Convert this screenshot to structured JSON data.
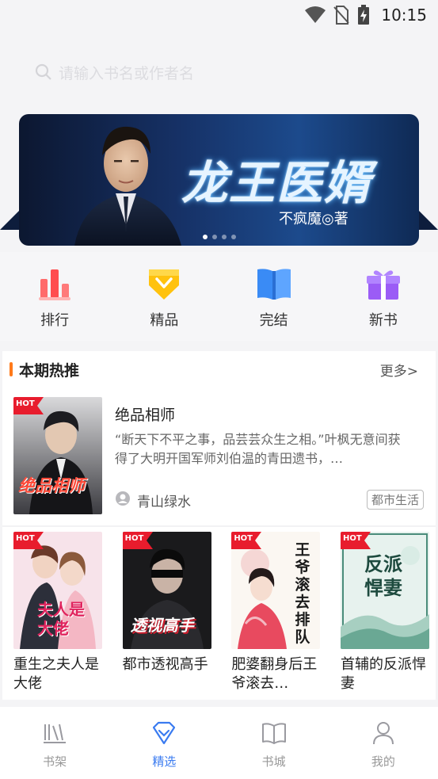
{
  "status_bar": {
    "time": "10:15",
    "icons": [
      "wifi-icon",
      "no-sim-icon",
      "battery-charging-icon"
    ]
  },
  "search": {
    "placeholder": "请输入书名或作者名",
    "icon": "search-icon"
  },
  "banner": {
    "title": "龙王医婿",
    "subtitle": "不疯魔◎著",
    "dots": 4,
    "active_dot": 0
  },
  "categories": [
    {
      "label": "排行",
      "icon": "ranking-bars-icon",
      "color": "#ff4d4f"
    },
    {
      "label": "精品",
      "icon": "diamond-badge-icon",
      "color": "#ffc20e"
    },
    {
      "label": "完结",
      "icon": "open-book-icon",
      "color": "#3a8bf5"
    },
    {
      "label": "新书",
      "icon": "gift-icon",
      "color": "#9b5cf6"
    }
  ],
  "section": {
    "title": "本期热推",
    "more": "更多>",
    "accent": "#ff7a1a",
    "feature": {
      "title": "绝品相师",
      "desc": "“断天下不平之事，品芸芸众生之相。”叶枫无意间获得了大明开国军师刘伯温的青田遗书，…",
      "author": "青山绿水",
      "tag": "都市生活",
      "cover_text": "绝品相师",
      "badge": "HOT"
    },
    "books": [
      {
        "title": "重生之夫人是大佬",
        "cover_text": "夫人是大佬",
        "badge": "HOT"
      },
      {
        "title": "都市透视高手",
        "cover_text": "透视高手",
        "badge": "HOT"
      },
      {
        "title": "肥婆翻身后王爷滚去…",
        "cover_text": "王爷滚去排队",
        "badge": "HOT"
      },
      {
        "title": "首辅的反派悍妻",
        "cover_text": "反派悍妻",
        "badge": "HOT"
      }
    ]
  },
  "tabbar": {
    "active": "精选",
    "active_color": "#3a7bf0",
    "tabs": [
      {
        "label": "书架",
        "icon": "bookshelf-icon"
      },
      {
        "label": "精选",
        "icon": "diamond-icon"
      },
      {
        "label": "书城",
        "icon": "book-icon"
      },
      {
        "label": "我的",
        "icon": "user-icon"
      }
    ]
  }
}
